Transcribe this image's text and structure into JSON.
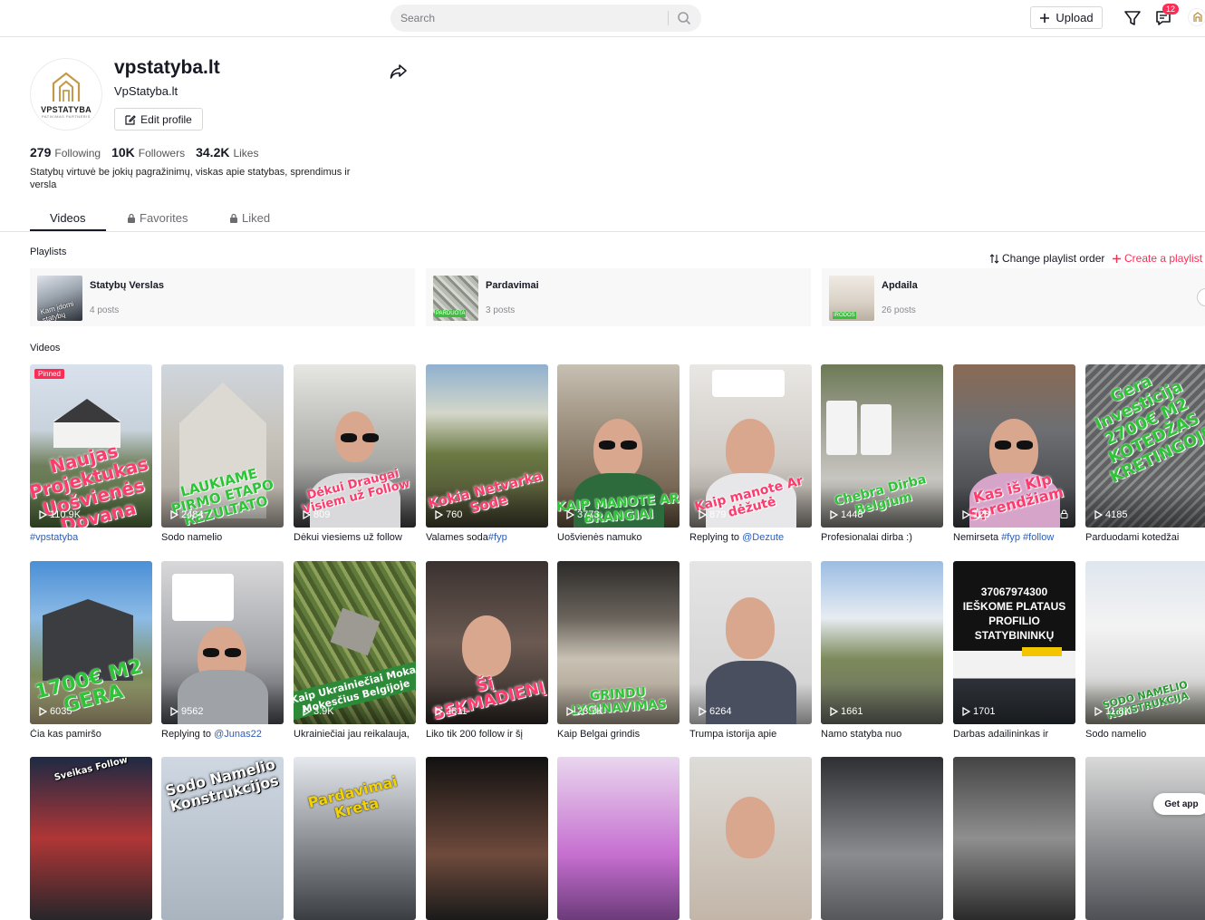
{
  "search": {
    "placeholder": "Search"
  },
  "header": {
    "upload_label": "Upload",
    "inbox_count": "12"
  },
  "profile": {
    "username": "vpstatyba.lt",
    "nickname": "VpStatyba.lt",
    "edit_label": "Edit profile",
    "avatar_brand": "VPSTATYBA",
    "avatar_tag": "PATIKIMAS PARTNERIS",
    "following_count": "279",
    "following_label": "Following",
    "followers_count": "10K",
    "followers_label": "Followers",
    "likes_count": "34.2K",
    "likes_label": "Likes",
    "bio": "Statybų virtuvė be jokių pagražinimų, viskas apie statybas, sprendimus ir versla"
  },
  "tabs": [
    {
      "label": "Videos"
    },
    {
      "label": "Favorites"
    },
    {
      "label": "Liked"
    }
  ],
  "playlists_section": {
    "title": "Playlists",
    "change_order": "Change playlist order",
    "create": "Create a playlist",
    "items": [
      {
        "name": "Statybų Verslas",
        "count": "4 posts"
      },
      {
        "name": "Pardavimai",
        "count": "3 posts"
      },
      {
        "name": "Apdaila",
        "count": "26 posts"
      }
    ]
  },
  "videos_section": {
    "title": "Videos",
    "pinned_label": "Pinned",
    "row1": [
      {
        "views": "110.9K",
        "caption": "#vpstatyba",
        "overlay": "Naujas Projektukas Uošvienės Dovana"
      },
      {
        "views": "2484",
        "caption": "Sodo namelio",
        "overlay": "LAUKIAME PIRMO ETAPO REZULTATO"
      },
      {
        "views": "809",
        "caption": "Dėkui viesiems už follow",
        "overlay": "Dėkui Draugai Visiem už Follow"
      },
      {
        "views": "760",
        "caption": "Valames soda",
        "caption_tag": "#fyp",
        "overlay": "Kokia Netvarka Sode"
      },
      {
        "views": "3773",
        "caption": "Uošvienės namuko",
        "overlay": "KAIP MANOTE AR BRANGIAI"
      },
      {
        "views": "879",
        "caption": "Replying to ",
        "caption_tag": "@Dezute",
        "overlay": "Kaip manote Ar dėžutė"
      },
      {
        "views": "1448",
        "caption": "Profesionalai dirba :)",
        "overlay": "Chebra Dirba Belgium"
      },
      {
        "views": "128",
        "caption": "Nemirseta ",
        "caption_tag": "#fyp #follow",
        "overlay": "Kas iš Klp Sprendžiam"
      },
      {
        "views": "4185",
        "caption": "Parduodami kotedžai",
        "overlay": "Gera Investicija 2700€ M2 KOTEDŽAS KRETINGOJE"
      }
    ],
    "row2": [
      {
        "views": "6035",
        "caption": "Čia kas pamiršo",
        "overlay": "1700€ M2 GERA"
      },
      {
        "views": "9562",
        "caption": "Replying to ",
        "caption_tag": "@Junas22",
        "overlay": ""
      },
      {
        "views": "3.9K",
        "caption": "Ukrainiečiai jau reikalauja,",
        "overlay": "Kaip Ukrainiečiai Moka Mokesčius Belgijoje"
      },
      {
        "views": "2811",
        "caption": "Liko tik 200 follow ir šį",
        "overlay": "Šį SEKMADIENĮ"
      },
      {
        "views": "23.7K",
        "caption": "Kaip Belgai grindis",
        "overlay": "GRINDŲ LYGINAVIMAS"
      },
      {
        "views": "6264",
        "caption": "Trumpa istorija apie",
        "overlay": ""
      },
      {
        "views": "1661",
        "caption": "Namo statyba nuo",
        "overlay": ""
      },
      {
        "views": "1701",
        "caption": "Darbas adailininkas ir",
        "overlay": "37067974300 IEŠKOME PLATAUS PROFILIO STATYBININKŲ"
      },
      {
        "views": "11.8K",
        "caption": "Sodo namelio",
        "overlay": "SODO NAMELIO KONSTRUKCIJA"
      }
    ],
    "row3_overlays": [
      "Sveikas Follow",
      "Sodo Namelio Konstrukcijos",
      "Pardavimai Kreta",
      "",
      "",
      "",
      "",
      "",
      ""
    ]
  },
  "get_app": "Get app",
  "colors": {
    "accent": "#fe2c55",
    "link": "#2b5db9",
    "text": "#161823"
  }
}
